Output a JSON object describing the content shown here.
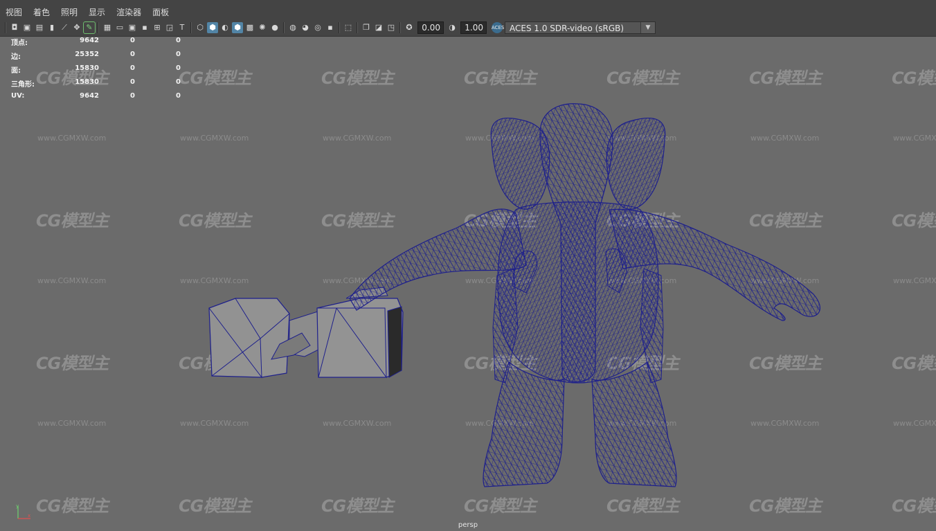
{
  "menu": [
    "视图",
    "着色",
    "照明",
    "显示",
    "渲染器",
    "面板"
  ],
  "toolbar": {
    "exposure_value": "0.00",
    "gamma_value": "1.00",
    "color_space_badge": "ACES",
    "color_space": "ACES 1.0 SDR-video (sRGB)"
  },
  "hud": {
    "rows": [
      {
        "label": "顶点:",
        "v1": "9642",
        "v2": "0",
        "v3": "0"
      },
      {
        "label": "边:",
        "v1": "25352",
        "v2": "0",
        "v3": "0"
      },
      {
        "label": "面:",
        "v1": "15830",
        "v2": "0",
        "v3": "0"
      },
      {
        "label": "三角形:",
        "v1": "15830",
        "v2": "0",
        "v3": "0"
      },
      {
        "label": "UV:",
        "v1": "9642",
        "v2": "0",
        "v3": "0"
      }
    ]
  },
  "watermark": {
    "logo": "CG模型主",
    "url": "www.CGMXW.com"
  },
  "camera_label": "persp",
  "colors": {
    "wireframe": "#1d1f8c",
    "background": "#6b6b6b",
    "active_button": "#5285a6"
  }
}
